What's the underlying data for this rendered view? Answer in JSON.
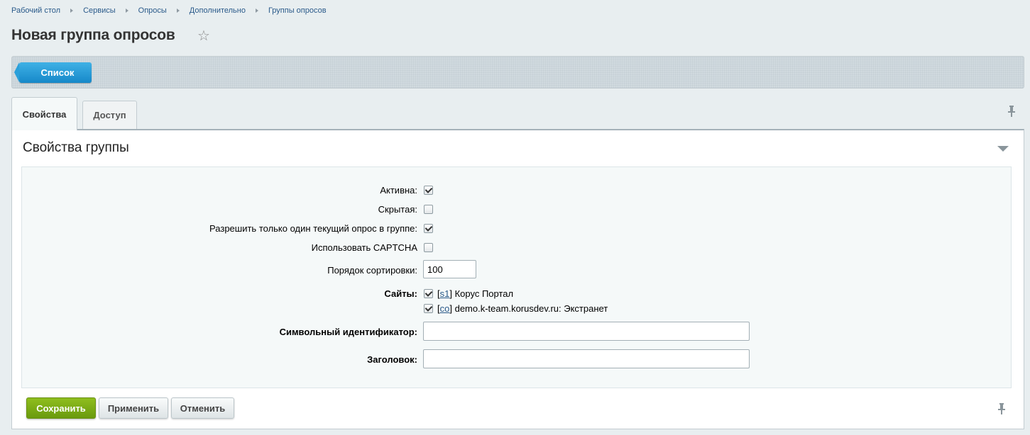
{
  "breadcrumb": [
    "Рабочий стол",
    "Сервисы",
    "Опросы",
    "Дополнительно",
    "Группы опросов"
  ],
  "page": {
    "title": "Новая группа опросов"
  },
  "toolbar": {
    "list_button": "Список"
  },
  "tabs": [
    {
      "label": "Свойства"
    },
    {
      "label": "Доступ"
    }
  ],
  "section": {
    "title": "Свойства группы"
  },
  "form": {
    "active": {
      "label": "Активна:",
      "checked": true
    },
    "hidden": {
      "label": "Скрытая:",
      "checked": false
    },
    "single_current": {
      "label": "Разрешить только один текущий опрос в группе:",
      "checked": true
    },
    "captcha": {
      "label": "Использовать CAPTCHA",
      "checked": false
    },
    "sort": {
      "label": "Порядок сортировки:",
      "value": "100"
    },
    "sites": {
      "label": "Сайты:",
      "items": [
        {
          "code": "s1",
          "name": "Корус Портал",
          "checked": true
        },
        {
          "code": "co",
          "name": "demo.k-team.korusdev.ru: Экстранет",
          "checked": true
        }
      ]
    },
    "symbolic_id": {
      "label": "Символьный идентификатор:",
      "value": ""
    },
    "heading": {
      "label": "Заголовок:",
      "value": ""
    }
  },
  "buttons": {
    "save": "Сохранить",
    "apply": "Применить",
    "cancel": "Отменить"
  }
}
